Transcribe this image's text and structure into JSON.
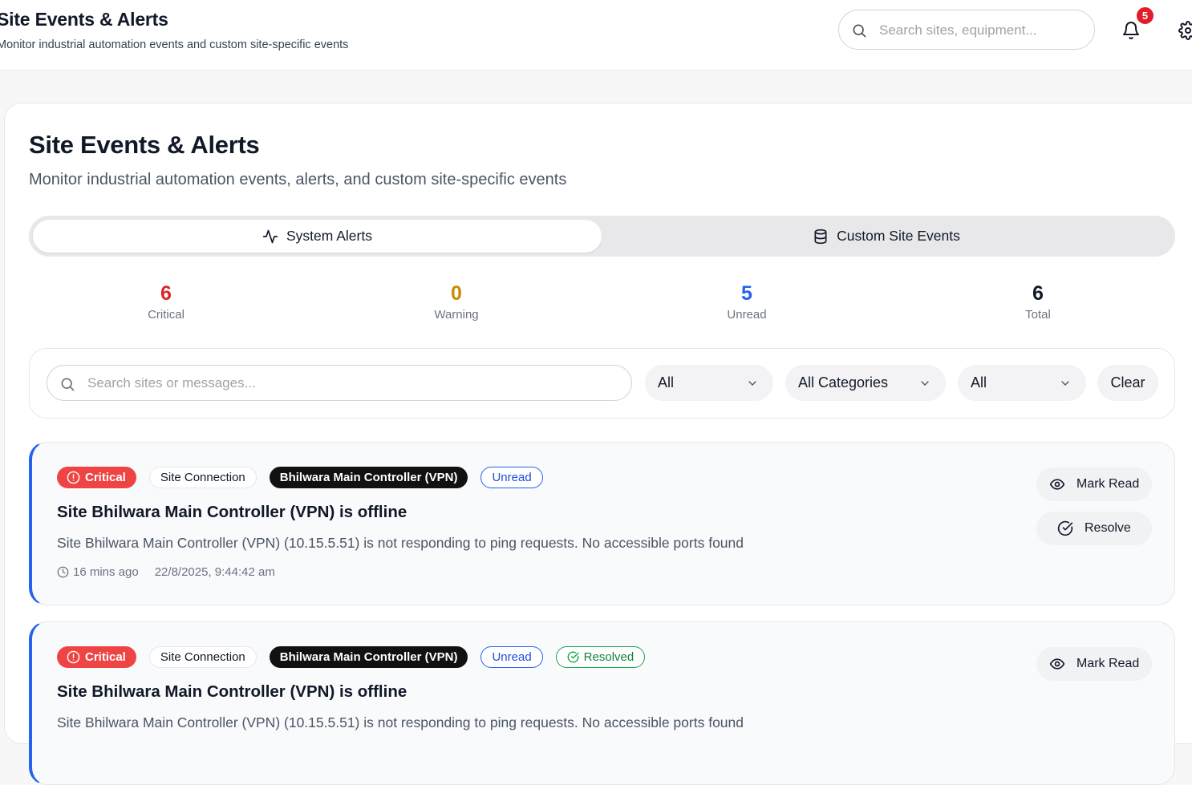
{
  "header": {
    "title": "Site Events & Alerts",
    "subtitle": "Monitor industrial automation events and custom site-specific events",
    "search_placeholder": "Search sites, equipment...",
    "notification_count": "5"
  },
  "page": {
    "title": "Site Events & Alerts",
    "subtitle": "Monitor industrial automation events, alerts, and custom site-specific events"
  },
  "tabs": [
    {
      "label": "System Alerts",
      "icon": "activity-icon",
      "active": true
    },
    {
      "label": "Custom Site Events",
      "icon": "database-icon",
      "active": false
    }
  ],
  "stats": [
    {
      "value": "6",
      "label": "Critical",
      "color": "#dc2626"
    },
    {
      "value": "0",
      "label": "Warning",
      "color": "#ca8a04"
    },
    {
      "value": "5",
      "label": "Unread",
      "color": "#2563eb"
    },
    {
      "value": "6",
      "label": "Total",
      "color": "#111827"
    }
  ],
  "filters": {
    "search_placeholder": "Search sites or messages...",
    "severity_value": "All",
    "category_value": "All Categories",
    "status_value": "All",
    "clear_label": "Clear"
  },
  "alerts": [
    {
      "severity": "Critical",
      "category": "Site Connection",
      "site": "Bhilwara Main Controller (VPN)",
      "unread": "Unread",
      "resolved": "",
      "title": "Site Bhilwara Main Controller (VPN) is offline",
      "message": "Site Bhilwara Main Controller (VPN) (10.15.5.51) is not responding to ping requests. No accessible ports found",
      "ago": "16 mins ago",
      "timestamp": "22/8/2025, 9:44:42 am",
      "mark_read_label": "Mark Read",
      "resolve_label": "Resolve"
    },
    {
      "severity": "Critical",
      "category": "Site Connection",
      "site": "Bhilwara Main Controller (VPN)",
      "unread": "Unread",
      "resolved": "Resolved",
      "title": "Site Bhilwara Main Controller (VPN) is offline",
      "message": "Site Bhilwara Main Controller (VPN) (10.15.5.51) is not responding to ping requests. No accessible ports found",
      "mark_read_label": "Mark Read"
    }
  ],
  "colors": {
    "accent_blue": "#2563eb",
    "critical_red": "#ef4444",
    "resolved_green": "#16a34a"
  }
}
